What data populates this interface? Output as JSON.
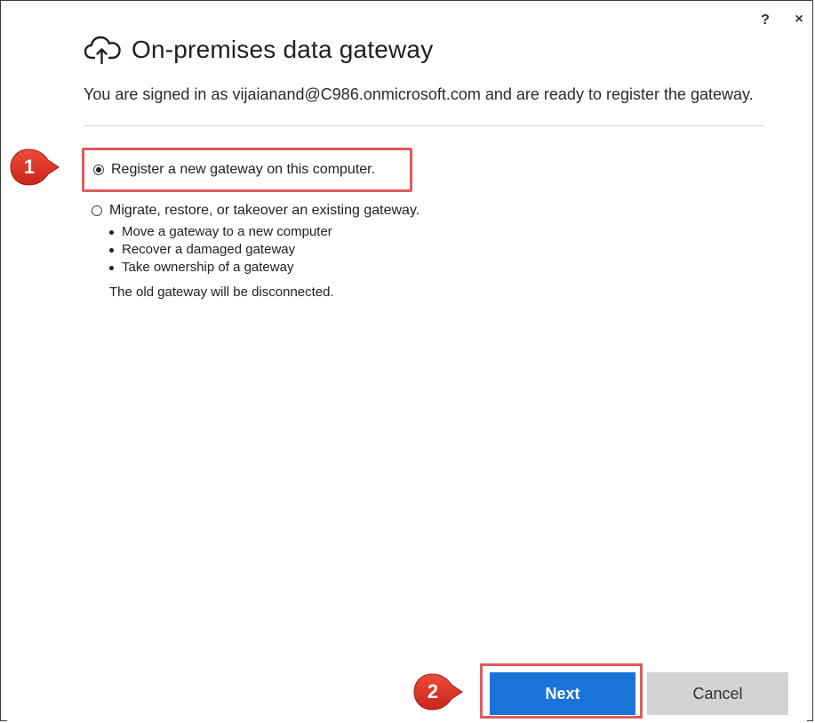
{
  "window": {
    "help_label": "?",
    "close_label": "×"
  },
  "header": {
    "title": "On-premises data gateway",
    "icon": "cloud-upload-icon"
  },
  "intro": {
    "text": "You are signed in as vijaianand@C986.onmicrosoft.com and are ready to register the gateway."
  },
  "options": {
    "register": {
      "label": "Register a new gateway on this computer.",
      "selected": true
    },
    "migrate": {
      "label": "Migrate, restore, or takeover an existing gateway.",
      "selected": false
    },
    "migrate_details": [
      "Move a gateway to a new computer",
      "Recover a damaged gateway",
      "Take ownership of a gateway"
    ],
    "footnote": "The old gateway will be disconnected."
  },
  "annotations": {
    "step1": "1",
    "step2": "2",
    "highlight_color": "#e25a5a"
  },
  "buttons": {
    "next": "Next",
    "cancel": "Cancel",
    "next_color": "#1a73d9",
    "cancel_color": "#d3d3d3"
  }
}
